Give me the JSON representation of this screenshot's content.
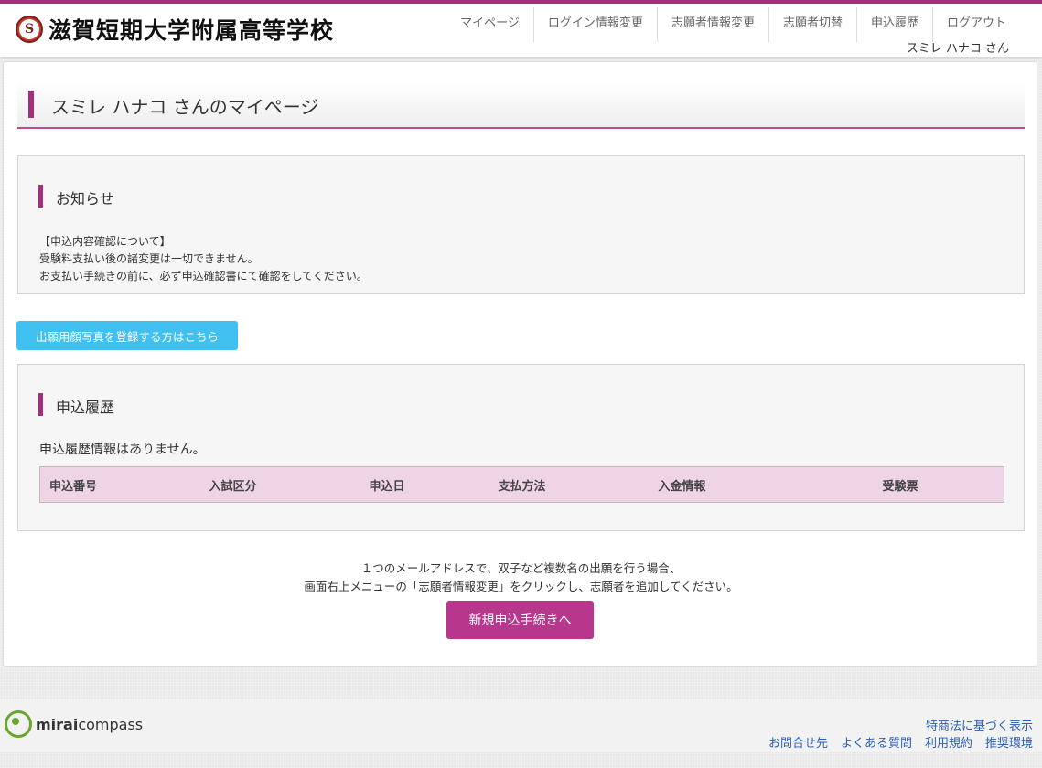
{
  "header": {
    "school_name": "滋賀短期大学附属高等学校",
    "logo_letter": "S",
    "nav": [
      "マイページ",
      "ログイン情報変更",
      "志願者情報変更",
      "志願者切替",
      "申込履歴",
      "ログアウト"
    ],
    "username": "スミレ ハナコ さん"
  },
  "page": {
    "title": "スミレ ハナコ さんのマイページ"
  },
  "notice": {
    "heading": "お知らせ",
    "lines": [
      "【申込内容確認について】",
      "受験料支払い後の諸変更は一切できません。",
      "お支払い手続きの前に、必ず申込確認書にて確認をしてください。"
    ]
  },
  "photo_button": "出願用顔写真を登録する方はこちら",
  "history": {
    "heading": "申込履歴",
    "empty_message": "申込履歴情報はありません。",
    "columns": [
      "申込番号",
      "入試区分",
      "申込日",
      "支払方法",
      "入金情報",
      "受験票"
    ]
  },
  "info": {
    "lines": [
      "１つのメールアドレスで、双子など複数名の出願を行う場合、",
      "画面右上メニューの「志願者情報変更」をクリックし、志願者を追加してください。"
    ]
  },
  "new_button": "新規申込手続きへ",
  "footer": {
    "brand_bold": "mirai",
    "brand_rest": "compass",
    "link_top": "特商法に基づく表示",
    "links": [
      "お問合せ先",
      "よくある質問",
      "利用規約",
      "推奨環境"
    ]
  },
  "colors": {
    "accent": "#a3307a",
    "photo_button": "#3fc0f0",
    "new_button": "#b7378d",
    "table_header": "#efd4e6",
    "link": "#2a5fb0"
  }
}
